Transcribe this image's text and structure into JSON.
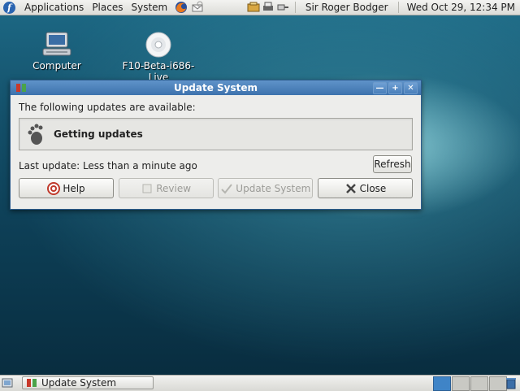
{
  "top_panel": {
    "menus": [
      "Applications",
      "Places",
      "System"
    ],
    "user": "Sir Roger Bodger",
    "clock": "Wed Oct 29, 12:34 PM"
  },
  "desktop": {
    "icons": [
      {
        "label": "Computer"
      },
      {
        "label": "F10-Beta-i686-Live"
      }
    ]
  },
  "window": {
    "title": "Update System",
    "available_label": "The following updates are available:",
    "status_text": "Getting updates",
    "last_update_label": "Last update:  Less than a minute ago",
    "buttons": {
      "refresh": "Refresh",
      "help": "Help",
      "review": "Review",
      "update_system": "Update System",
      "close": "Close"
    }
  },
  "bottom_panel": {
    "task": "Update System",
    "workspaces_count": 4,
    "active_workspace": 1
  },
  "colors": {
    "titlebar": "#3d72ad",
    "active_workspace": "#3f84c7"
  }
}
